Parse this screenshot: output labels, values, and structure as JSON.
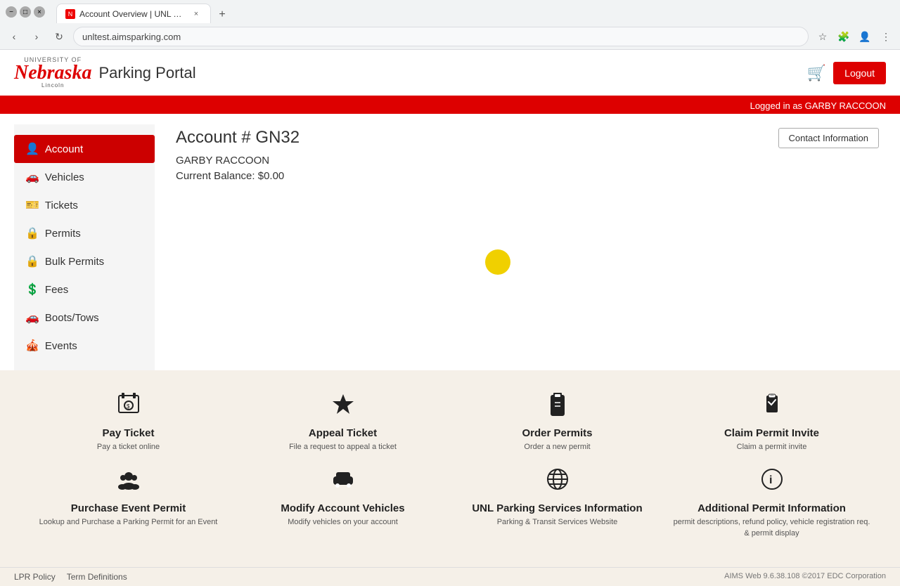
{
  "browser": {
    "tab_title": "Account Overview | UNL Parking ...",
    "tab_favicon": "N",
    "address": "unltest.aimsparking.com",
    "new_tab_label": "+"
  },
  "header": {
    "logo_top": "UNIVERSITY OF",
    "logo_main": "Nebraska",
    "logo_sub": "Lincoln",
    "site_title": "Parking Portal",
    "logout_label": "Logout",
    "logged_in_text": "Logged in as GARBY RACCOON"
  },
  "sidebar": {
    "items": [
      {
        "id": "account",
        "label": "Account",
        "icon": "👤",
        "active": true
      },
      {
        "id": "vehicles",
        "label": "Vehicles",
        "icon": "🚗"
      },
      {
        "id": "tickets",
        "label": "Tickets",
        "icon": "🎫"
      },
      {
        "id": "permits",
        "label": "Permits",
        "icon": "🔒"
      },
      {
        "id": "bulk-permits",
        "label": "Bulk Permits",
        "icon": "🔒"
      },
      {
        "id": "fees",
        "label": "Fees",
        "icon": "💲"
      },
      {
        "id": "boots-tows",
        "label": "Boots/Tows",
        "icon": "🚗"
      },
      {
        "id": "events",
        "label": "Events",
        "icon": "🎪"
      }
    ]
  },
  "account": {
    "title": "Account # GN32",
    "name": "GARBY RACCOON",
    "balance_label": "Current Balance:",
    "balance_value": "$0.00",
    "contact_info_label": "Contact Information"
  },
  "footer_actions": {
    "row1": [
      {
        "id": "pay-ticket",
        "title": "Pay Ticket",
        "desc": "Pay a ticket online"
      },
      {
        "id": "appeal-ticket",
        "title": "Appeal Ticket",
        "desc": "File a request to appeal a ticket"
      },
      {
        "id": "order-permits",
        "title": "Order Permits",
        "desc": "Order a new permit"
      },
      {
        "id": "claim-permit-invite",
        "title": "Claim Permit Invite",
        "desc": "Claim a permit invite"
      }
    ],
    "row2": [
      {
        "id": "purchase-event-permit",
        "title": "Purchase Event Permit",
        "desc": "Lookup and Purchase a Parking Permit for an Event"
      },
      {
        "id": "modify-account-vehicles",
        "title": "Modify Account Vehicles",
        "desc": "Modify vehicles on your account"
      },
      {
        "id": "unl-parking-services",
        "title": "UNL Parking Services Information",
        "desc": "Parking & Transit Services Website"
      },
      {
        "id": "additional-permit-info",
        "title": "Additional Permit Information",
        "desc": "permit descriptions, refund policy, vehicle registration req. & permit display"
      }
    ]
  },
  "site_footer": {
    "lpr_policy": "LPR Policy",
    "term_definitions": "Term Definitions",
    "copyright": "AIMS Web 9.6.38.108 ©2017 EDC Corporation"
  }
}
